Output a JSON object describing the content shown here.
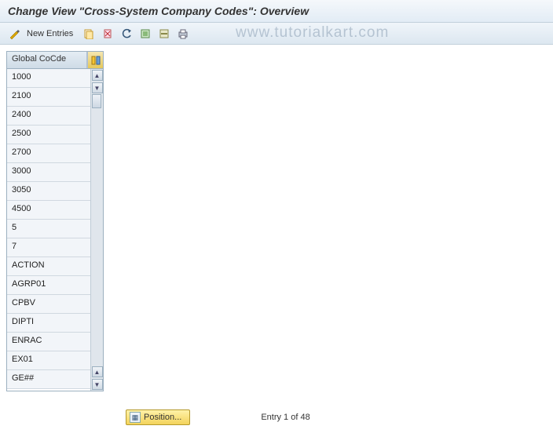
{
  "header": {
    "title": "Change View \"Cross-System Company Codes\": Overview"
  },
  "toolbar": {
    "new_entries_label": "New Entries"
  },
  "watermark": "www.tutorialkart.com",
  "grid": {
    "header": "Global CoCde",
    "rows": [
      "1000",
      "2100",
      "2400",
      "2500",
      "2700",
      "3000",
      "3050",
      "4500",
      "5",
      "7",
      "ACTION",
      "AGRP01",
      "CPBV",
      "DIPTI",
      "ENRAC",
      "EX01",
      "GE##"
    ]
  },
  "footer": {
    "position_label": "Position...",
    "entry_text": "Entry 1 of 48"
  }
}
